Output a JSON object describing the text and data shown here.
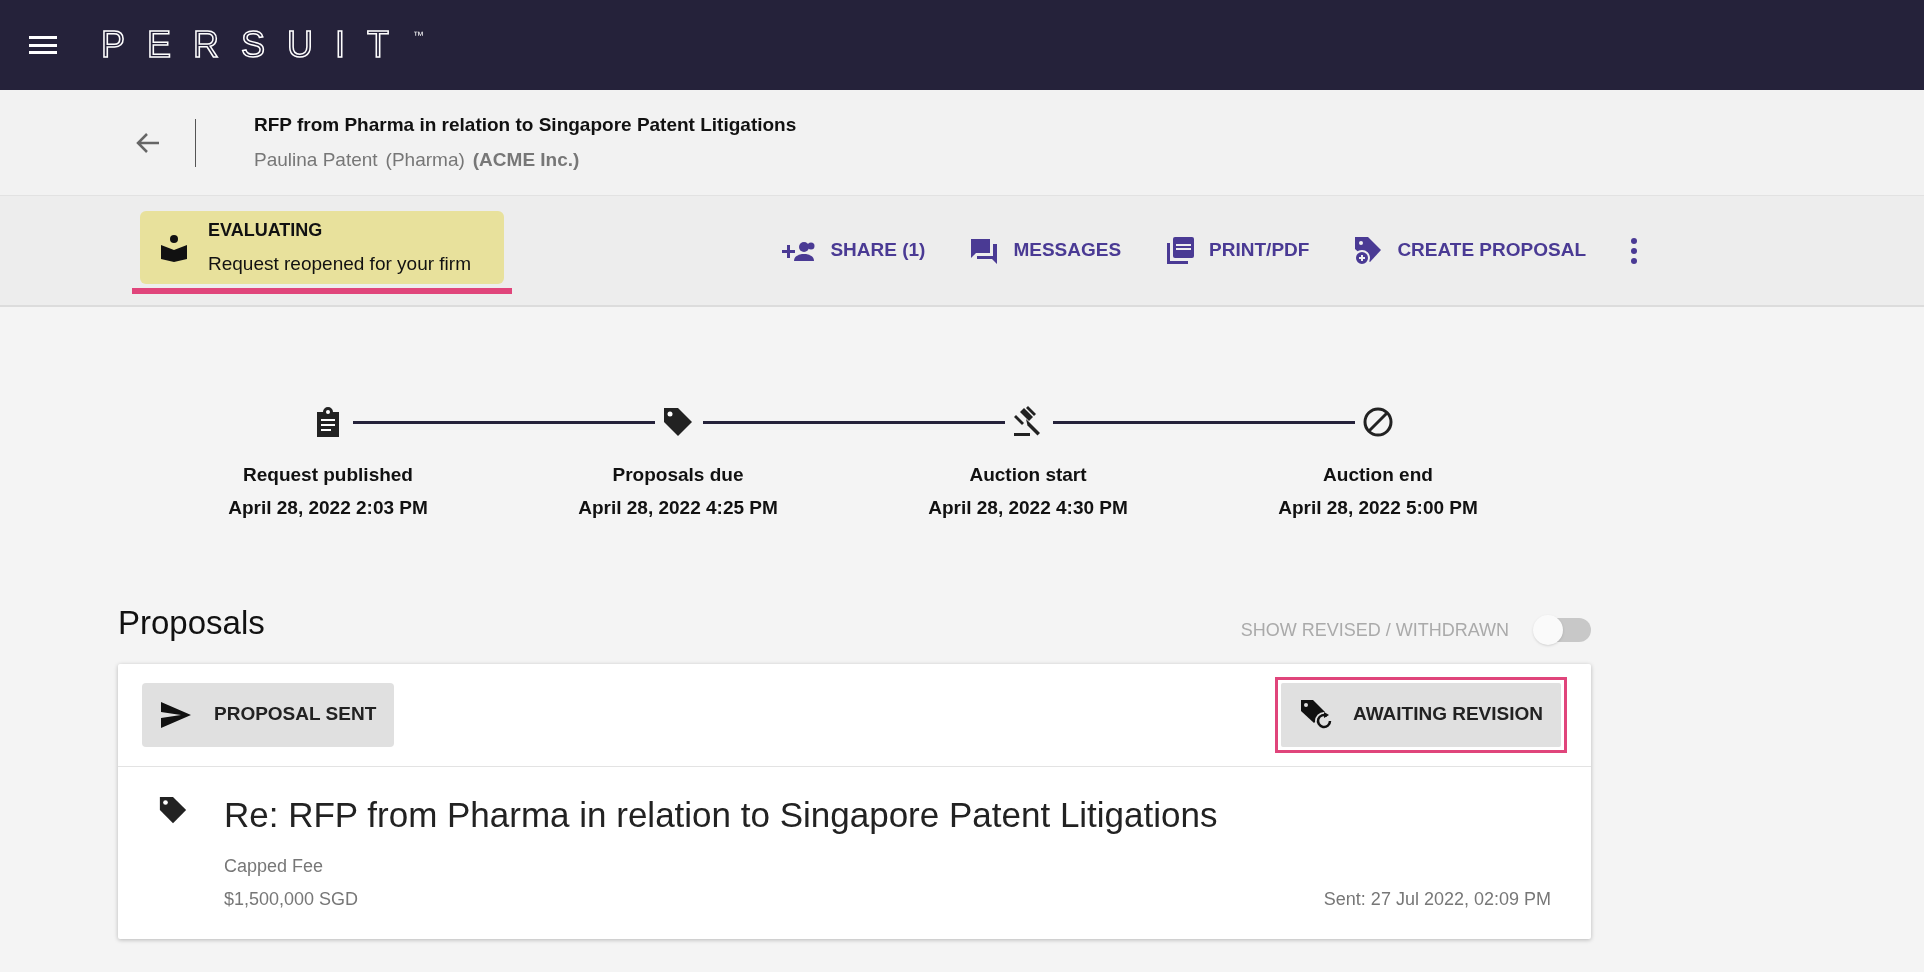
{
  "app_bar": {
    "logo": "PERSUIT",
    "trademark": "™"
  },
  "request": {
    "title": "RFP from Pharma in relation to Singapore Patent Litigations",
    "requester": "Paulina Patent",
    "requester_org": "(Pharma)",
    "firm": "(ACME Inc.)"
  },
  "status": {
    "label": "EVALUATING",
    "detail": "Request reopened for your firm",
    "highlighted": true
  },
  "actions": [
    {
      "kind": "share",
      "label": "SHARE (1)"
    },
    {
      "kind": "messages",
      "label": "MESSAGES"
    },
    {
      "kind": "print",
      "label": "PRINT/PDF"
    },
    {
      "kind": "create",
      "label": "CREATE PROPOSAL"
    }
  ],
  "timeline": [
    {
      "kind": "published",
      "label": "Request published",
      "date": "April 28, 2022 2:03 PM"
    },
    {
      "kind": "due",
      "label": "Proposals due",
      "date": "April 28, 2022 4:25 PM"
    },
    {
      "kind": "auction_start",
      "label": "Auction start",
      "date": "April 28, 2022 4:30 PM"
    },
    {
      "kind": "auction_end",
      "label": "Auction end",
      "date": "April 28, 2022 5:00 PM"
    }
  ],
  "proposals": {
    "heading": "Proposals",
    "toggle": {
      "label": "SHOW REVISED / WITHDRAWN",
      "on": false
    },
    "items": [
      {
        "sent_badge": "PROPOSAL SENT",
        "revision_badge": "AWAITING REVISION",
        "revision_highlighted": true,
        "title": "Re: RFP from Pharma in relation to Singapore Patent Litigations",
        "fee_type": "Capped Fee",
        "amount": "$1,500,000 SGD",
        "sent": "Sent: 27 Jul 2022, 02:09 PM"
      }
    ]
  }
}
